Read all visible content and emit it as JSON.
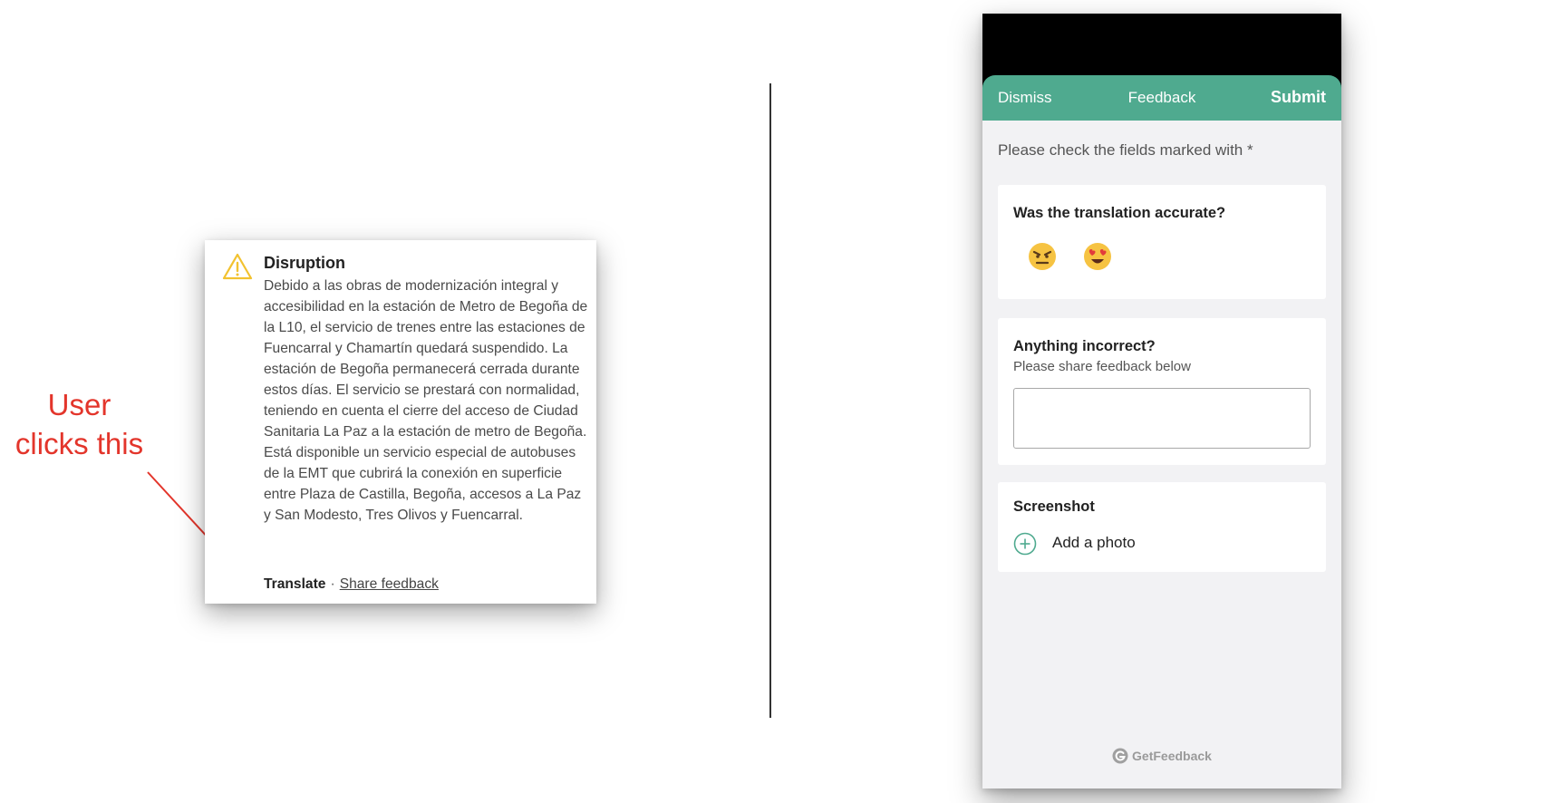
{
  "annotation": {
    "text_line1": "User",
    "text_line2": "clicks this",
    "color": "#e3352b"
  },
  "disruption_card": {
    "icon": "warning-triangle-icon",
    "title": "Disruption",
    "body": "Debido a las obras de modernización integral y accesibilidad en la estación de Metro de Begoña de la L10, el servicio de trenes entre las estaciones de Fuencarral y Chamartín quedará suspendido. La estación de Begoña permanecerá cerrada durante estos días. El servicio se prestará con normalidad, teniendo en cuenta el cierre del acceso de Ciudad Sanitaria La Paz a la estación de metro de Begoña. Está disponible un servicio especial de autobuses de la EMT que cubrirá la conexión en superficie entre Plaza de Castilla, Begoña, accesos a La Paz y San Modesto, Tres Olivos y Fuencarral.",
    "translate_label": "Translate",
    "separator": "·",
    "share_label": "Share feedback"
  },
  "feedback_form": {
    "header": {
      "dismiss_label": "Dismiss",
      "title": "Feedback",
      "submit_label": "Submit",
      "color": "#4faa8f"
    },
    "notice": "Please check the fields marked with *",
    "accuracy": {
      "question": "Was the translation accurate?",
      "options": [
        "angry-face-icon",
        "heart-eyes-face-icon"
      ]
    },
    "incorrect": {
      "question": "Anything incorrect?",
      "subtitle": "Please share feedback below",
      "value": "",
      "placeholder": ""
    },
    "screenshot": {
      "title": "Screenshot",
      "add_photo_label": "Add a photo",
      "icon": "plus-circle-icon"
    },
    "branding": {
      "label": "GetFeedback",
      "icon": "getfeedback-logo-icon"
    }
  }
}
